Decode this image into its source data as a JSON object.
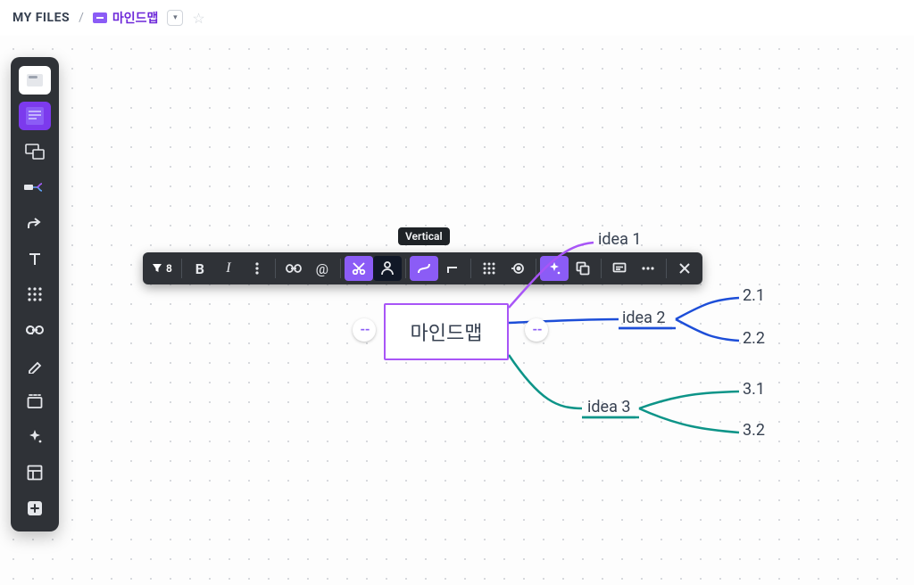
{
  "breadcrumbs": {
    "root": "MY FILES",
    "document": "마인드맵"
  },
  "tooltip": "Vertical",
  "toolbar_count": "8",
  "mindmap": {
    "center": "마인드맵",
    "branches": {
      "idea1": {
        "label": "idea 1",
        "color": "#8b5cf6"
      },
      "idea2": {
        "label": "idea 2",
        "color": "#1d4ed8",
        "children": [
          {
            "label": "2.1"
          },
          {
            "label": "2.2"
          }
        ]
      },
      "idea3": {
        "label": "idea 3",
        "color": "#0d9488",
        "children": [
          {
            "label": "3.1"
          },
          {
            "label": "3.2"
          }
        ]
      }
    }
  },
  "sidebar_tools": [
    "card",
    "sticky-note",
    "frame",
    "mindmap",
    "arrow",
    "text",
    "grid",
    "link",
    "pencil",
    "section",
    "sparkle",
    "layout",
    "add"
  ],
  "floating_tools": [
    "filter",
    "bold",
    "italic",
    "more-text",
    "link",
    "mention",
    "cut",
    "person",
    "connector",
    "elbow",
    "grid",
    "target",
    "ai",
    "copy",
    "comment",
    "more",
    "close"
  ]
}
